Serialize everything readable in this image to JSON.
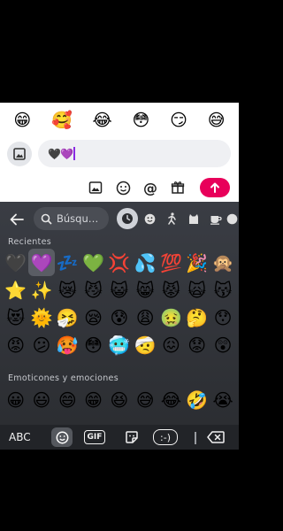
{
  "reactions": [
    "😁",
    "🥰",
    "😂",
    "😳",
    "😏",
    "😅"
  ],
  "composer": {
    "message_value": "🖤💜",
    "attach_icon": "image-icon"
  },
  "toolbar": {
    "icons": [
      "image-icon",
      "emoji-icon",
      "mention-icon",
      "gift-icon"
    ],
    "send_icon": "arrow-up-icon",
    "send_color": "#e8005a"
  },
  "emoji_keyboard": {
    "search_placeholder": "Búsqu…",
    "category_icons": [
      "clock-icon",
      "smiley-icon",
      "person-icon",
      "cat-icon",
      "coffee-icon",
      "ball-icon",
      "car-icon"
    ],
    "recent_label": "Recientes",
    "recent_emojis": [
      "🖤",
      "💜",
      "💤",
      "💚",
      "💢",
      "💦",
      "💯",
      "🎉",
      "🙊",
      "⭐",
      "✨",
      "😿",
      "😼",
      "😺",
      "😸",
      "😾",
      "🙀",
      "😽",
      "😻",
      "🌞",
      "🤧",
      "😪",
      "😰",
      "😩",
      "🤢",
      "🤔",
      "😯",
      "😡",
      "😕",
      "🥵",
      "😳",
      "🥶",
      "🤕",
      "😖",
      "😟",
      "😲"
    ],
    "selected_recent_index": 1,
    "smileys_label": "Emoticones y emociones",
    "smiley_emojis": [
      "😀",
      "😃",
      "😄",
      "😁",
      "😆",
      "😅",
      "😂",
      "🤣",
      "😭"
    ]
  },
  "bottom_bar": {
    "abc_label": "ABC",
    "gif_label": "GIF",
    "emoticon_label": ":-)"
  }
}
